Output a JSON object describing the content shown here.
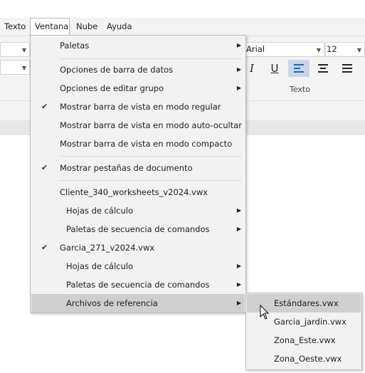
{
  "menubar": {
    "items": [
      {
        "label": "Texto"
      },
      {
        "label": "Ventana"
      },
      {
        "label": "Nube"
      },
      {
        "label": "Ayuda"
      }
    ]
  },
  "toolbar": {
    "font_name": "Arial",
    "font_size": "12",
    "group_label": "Texto",
    "italic_label": "I",
    "underline_label": "U"
  },
  "ventana_menu": {
    "items": [
      {
        "label": "Paletas",
        "has_submenu": true
      },
      {
        "label": "Opciones de barra de datos",
        "has_submenu": true
      },
      {
        "label": "Opciones de editar grupo",
        "has_submenu": true
      },
      {
        "label": "Mostrar barra de vista en modo regular",
        "checked": true
      },
      {
        "label": "Mostrar barra de vista en modo auto-ocultar"
      },
      {
        "label": "Mostrar barra de vista en modo compacto"
      },
      {
        "label": "Mostrar pestañas de documento",
        "checked": true
      },
      {
        "label": "Cliente_340_worksheets_v2024.vwx"
      },
      {
        "label": "Hojas de cálculo",
        "has_submenu": true
      },
      {
        "label": "Paletas de secuencia de comandos",
        "has_submenu": true
      },
      {
        "label": "Garcia_271_v2024.vwx",
        "checked": true
      },
      {
        "label": "Hojas de cálculo",
        "has_submenu": true
      },
      {
        "label": "Paletas de secuencia de comandos",
        "has_submenu": true
      },
      {
        "label": "Archivos de referencia",
        "has_submenu": true,
        "highlighted": true
      }
    ]
  },
  "referencias_submenu": {
    "items": [
      {
        "label": "Estándares.vwx",
        "highlighted": true
      },
      {
        "label": "Garcia_jardin.vwx"
      },
      {
        "label": "Zona_Este.vwx"
      },
      {
        "label": "Zona_Oeste.vwx"
      }
    ]
  },
  "icons": {
    "check": "checkmark-icon",
    "submenu_arrow": "chevron-right-icon",
    "cursor": "mouse-pointer-icon"
  }
}
